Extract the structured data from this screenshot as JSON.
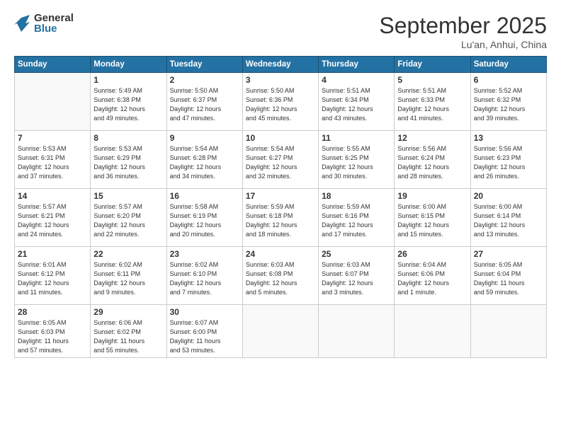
{
  "header": {
    "logo": {
      "general": "General",
      "blue": "Blue"
    },
    "month": "September 2025",
    "location": "Lu'an, Anhui, China"
  },
  "weekdays": [
    "Sunday",
    "Monday",
    "Tuesday",
    "Wednesday",
    "Thursday",
    "Friday",
    "Saturday"
  ],
  "weeks": [
    [
      {
        "day": "",
        "info": ""
      },
      {
        "day": "1",
        "info": "Sunrise: 5:49 AM\nSunset: 6:38 PM\nDaylight: 12 hours\nand 49 minutes."
      },
      {
        "day": "2",
        "info": "Sunrise: 5:50 AM\nSunset: 6:37 PM\nDaylight: 12 hours\nand 47 minutes."
      },
      {
        "day": "3",
        "info": "Sunrise: 5:50 AM\nSunset: 6:36 PM\nDaylight: 12 hours\nand 45 minutes."
      },
      {
        "day": "4",
        "info": "Sunrise: 5:51 AM\nSunset: 6:34 PM\nDaylight: 12 hours\nand 43 minutes."
      },
      {
        "day": "5",
        "info": "Sunrise: 5:51 AM\nSunset: 6:33 PM\nDaylight: 12 hours\nand 41 minutes."
      },
      {
        "day": "6",
        "info": "Sunrise: 5:52 AM\nSunset: 6:32 PM\nDaylight: 12 hours\nand 39 minutes."
      }
    ],
    [
      {
        "day": "7",
        "info": "Sunrise: 5:53 AM\nSunset: 6:31 PM\nDaylight: 12 hours\nand 37 minutes."
      },
      {
        "day": "8",
        "info": "Sunrise: 5:53 AM\nSunset: 6:29 PM\nDaylight: 12 hours\nand 36 minutes."
      },
      {
        "day": "9",
        "info": "Sunrise: 5:54 AM\nSunset: 6:28 PM\nDaylight: 12 hours\nand 34 minutes."
      },
      {
        "day": "10",
        "info": "Sunrise: 5:54 AM\nSunset: 6:27 PM\nDaylight: 12 hours\nand 32 minutes."
      },
      {
        "day": "11",
        "info": "Sunrise: 5:55 AM\nSunset: 6:25 PM\nDaylight: 12 hours\nand 30 minutes."
      },
      {
        "day": "12",
        "info": "Sunrise: 5:56 AM\nSunset: 6:24 PM\nDaylight: 12 hours\nand 28 minutes."
      },
      {
        "day": "13",
        "info": "Sunrise: 5:56 AM\nSunset: 6:23 PM\nDaylight: 12 hours\nand 26 minutes."
      }
    ],
    [
      {
        "day": "14",
        "info": "Sunrise: 5:57 AM\nSunset: 6:21 PM\nDaylight: 12 hours\nand 24 minutes."
      },
      {
        "day": "15",
        "info": "Sunrise: 5:57 AM\nSunset: 6:20 PM\nDaylight: 12 hours\nand 22 minutes."
      },
      {
        "day": "16",
        "info": "Sunrise: 5:58 AM\nSunset: 6:19 PM\nDaylight: 12 hours\nand 20 minutes."
      },
      {
        "day": "17",
        "info": "Sunrise: 5:59 AM\nSunset: 6:18 PM\nDaylight: 12 hours\nand 18 minutes."
      },
      {
        "day": "18",
        "info": "Sunrise: 5:59 AM\nSunset: 6:16 PM\nDaylight: 12 hours\nand 17 minutes."
      },
      {
        "day": "19",
        "info": "Sunrise: 6:00 AM\nSunset: 6:15 PM\nDaylight: 12 hours\nand 15 minutes."
      },
      {
        "day": "20",
        "info": "Sunrise: 6:00 AM\nSunset: 6:14 PM\nDaylight: 12 hours\nand 13 minutes."
      }
    ],
    [
      {
        "day": "21",
        "info": "Sunrise: 6:01 AM\nSunset: 6:12 PM\nDaylight: 12 hours\nand 11 minutes."
      },
      {
        "day": "22",
        "info": "Sunrise: 6:02 AM\nSunset: 6:11 PM\nDaylight: 12 hours\nand 9 minutes."
      },
      {
        "day": "23",
        "info": "Sunrise: 6:02 AM\nSunset: 6:10 PM\nDaylight: 12 hours\nand 7 minutes."
      },
      {
        "day": "24",
        "info": "Sunrise: 6:03 AM\nSunset: 6:08 PM\nDaylight: 12 hours\nand 5 minutes."
      },
      {
        "day": "25",
        "info": "Sunrise: 6:03 AM\nSunset: 6:07 PM\nDaylight: 12 hours\nand 3 minutes."
      },
      {
        "day": "26",
        "info": "Sunrise: 6:04 AM\nSunset: 6:06 PM\nDaylight: 12 hours\nand 1 minute."
      },
      {
        "day": "27",
        "info": "Sunrise: 6:05 AM\nSunset: 6:04 PM\nDaylight: 11 hours\nand 59 minutes."
      }
    ],
    [
      {
        "day": "28",
        "info": "Sunrise: 6:05 AM\nSunset: 6:03 PM\nDaylight: 11 hours\nand 57 minutes."
      },
      {
        "day": "29",
        "info": "Sunrise: 6:06 AM\nSunset: 6:02 PM\nDaylight: 11 hours\nand 55 minutes."
      },
      {
        "day": "30",
        "info": "Sunrise: 6:07 AM\nSunset: 6:00 PM\nDaylight: 11 hours\nand 53 minutes."
      },
      {
        "day": "",
        "info": ""
      },
      {
        "day": "",
        "info": ""
      },
      {
        "day": "",
        "info": ""
      },
      {
        "day": "",
        "info": ""
      }
    ]
  ]
}
